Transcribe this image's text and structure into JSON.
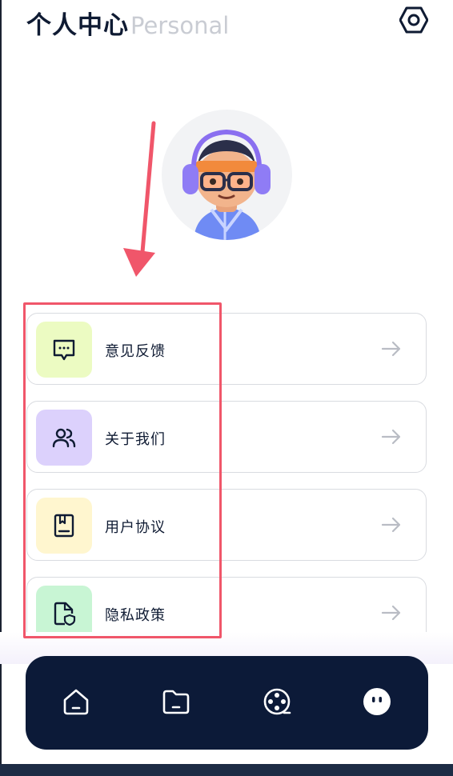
{
  "header": {
    "title_zh": "个人中心",
    "title_en": "Personal"
  },
  "icons": {
    "settings": "hexagon-settings-icon"
  },
  "menu": [
    {
      "label": "意见反馈",
      "icon": "feedback-icon",
      "tile_color": "#ecfbc2"
    },
    {
      "label": "关于我们",
      "icon": "users-icon",
      "tile_color": "#dcd1fc"
    },
    {
      "label": "用户协议",
      "icon": "document-icon",
      "tile_color": "#fff6cf"
    },
    {
      "label": "隐私政策",
      "icon": "privacy-file-icon",
      "tile_color": "#c8f5d4"
    }
  ],
  "tabbar": {
    "items": [
      {
        "icon": "home-icon",
        "active": false
      },
      {
        "icon": "folder-icon",
        "active": false
      },
      {
        "icon": "film-reel-icon",
        "active": false
      },
      {
        "icon": "profile-face-icon",
        "active": true
      }
    ]
  },
  "colors": {
    "accent_dark": "#0c1a38",
    "annotation_red": "#f0566a"
  }
}
